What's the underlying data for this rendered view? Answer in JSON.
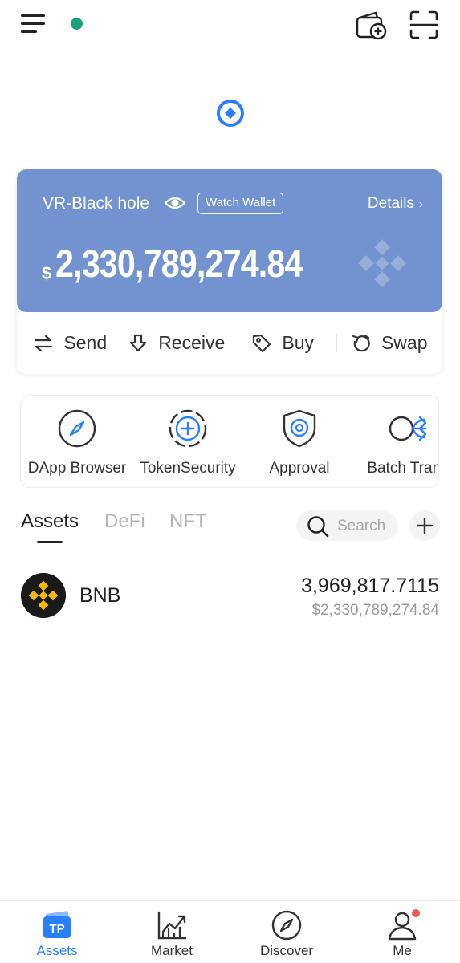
{
  "colors": {
    "accent": "#2980FE",
    "card_bg": "#7293cf",
    "status_dot": "#17a07a",
    "bnb_gold": "#f0b90b",
    "notification": "#ef5a4c"
  },
  "header": {
    "icons": [
      "menu-icon",
      "status-dot",
      "wallet-add-icon",
      "scan-icon"
    ]
  },
  "wallet": {
    "name": "VR-Black hole",
    "badge": "Watch Wallet",
    "details_label": "Details",
    "currency_symbol": "$",
    "balance": "2,330,789,274.84"
  },
  "actions": [
    {
      "label": "Send",
      "icon": "send-icon"
    },
    {
      "label": "Receive",
      "icon": "receive-icon"
    },
    {
      "label": "Buy",
      "icon": "buy-tag-icon"
    },
    {
      "label": "Swap",
      "icon": "swap-icon"
    }
  ],
  "tools": [
    {
      "label": "DApp Browser",
      "icon": "compass-icon"
    },
    {
      "label": "TokenSecurity",
      "icon": "token-security-icon"
    },
    {
      "label": "Approval",
      "icon": "shield-icon"
    },
    {
      "label": "Batch Trans",
      "icon": "batch-transfer-icon"
    }
  ],
  "tabs": [
    {
      "label": "Assets",
      "active": true
    },
    {
      "label": "DeFi",
      "active": false
    },
    {
      "label": "NFT",
      "active": false
    }
  ],
  "search": {
    "placeholder": "Search"
  },
  "assets": [
    {
      "symbol": "BNB",
      "amount": "3,969,817.7115",
      "value": "$2,330,789,274.84",
      "icon": "bnb-icon"
    }
  ],
  "bottom_nav": [
    {
      "label": "Assets",
      "active": true,
      "icon": "tp-wallet-icon"
    },
    {
      "label": "Market",
      "active": false,
      "icon": "market-chart-icon"
    },
    {
      "label": "Discover",
      "active": false,
      "icon": "discover-compass-icon"
    },
    {
      "label": "Me",
      "active": false,
      "icon": "profile-icon",
      "has_notification": true
    }
  ]
}
